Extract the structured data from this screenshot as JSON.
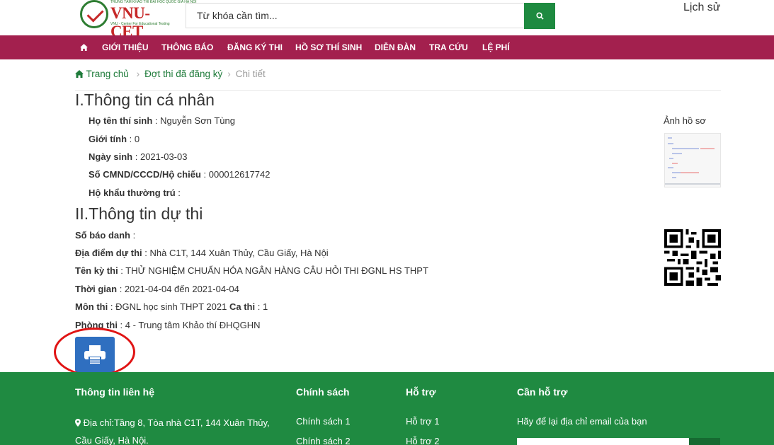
{
  "header": {
    "logo_text": "VNU-CET",
    "logo_top": "TRUNG TÂM KHẢO THÍ ĐẠI HỌC QUỐC GIA HÀ NỘI",
    "logo_sub": "VNU - Center For Educational Testing",
    "search_placeholder": "Từ khóa cần tìm...",
    "history_label": "Lịch sử"
  },
  "nav": {
    "home_icon": "home-icon",
    "items": [
      {
        "label": "GIỚI THIỆU"
      },
      {
        "label": "THÔNG BÁO"
      },
      {
        "label": "ĐĂNG KÝ THI"
      },
      {
        "label": "HỒ SƠ THÍ SINH"
      },
      {
        "label": "DIỄN ĐÀN"
      },
      {
        "label": "TRA CỨU"
      },
      {
        "label": "LỆ PHÍ"
      }
    ]
  },
  "breadcrumb": {
    "home": "Trang chủ",
    "registered": "Đợt thi đã đăng ký",
    "current": "Chi tiết"
  },
  "personal": {
    "title": "I.Thông tin cá nhân",
    "name_label": "Họ tên thí sinh",
    "name_value": "Nguyễn Sơn Tùng",
    "gender_label": "Giới tính",
    "gender_value": "0",
    "dob_label": "Ngày sinh",
    "dob_value": "2021-03-03",
    "id_label": "Số CMND/CCCD/Hộ chiếu",
    "id_value": "000012617742",
    "residence_label": "Hộ khẩu thường trú",
    "residence_value": ""
  },
  "photo": {
    "label": "Ảnh hồ sơ"
  },
  "exam": {
    "title": "II.Thông tin dự thi",
    "sbd_label": "Số báo danh",
    "sbd_value": "",
    "location_label": "Địa điểm dự thi",
    "location_value": "Nhà C1T, 144 Xuân Thủy, Cầu Giấy, Hà Nội",
    "exam_name_label": "Tên kỳ thi",
    "exam_name_value": "THỬ NGHIỆM CHUẨN HÓA NGÂN HÀNG CÂU HỎI THI ĐGNL HS THPT",
    "time_label": "Thời gian",
    "time_value": "2021-04-04 đến 2021-04-04",
    "subject_label": "Môn thi",
    "subject_value": "ĐGNL học sinh THPT 2021",
    "session_label": "Ca thi",
    "session_value": "1",
    "room_label": "Phòng thi",
    "room_value": "4 - Trung tâm Khảo thí ĐHQGHN"
  },
  "print_icon": "printer-icon",
  "footer": {
    "contact_title": "Thông tin liên hệ",
    "address_line1": "Địa chỉ:Tầng 8, Tòa nhà C1T, 144 Xuân Thủy,",
    "address_line2": "Cầu Giấy, Hà Nội.",
    "policy_title": "Chính sách",
    "policy_1": "Chính sách 1",
    "policy_2": "Chính sách 2",
    "support_title": "Hỗ trợ",
    "support_1": "Hỗ trợ 1",
    "support_2": "Hỗ trợ 2",
    "need_help_title": "Cần hỗ trợ",
    "need_help_text": "Hãy để lại địa chỉ email của bạn"
  },
  "colors": {
    "nav_bg": "#a3204e",
    "footer_bg": "#1f8a41",
    "accent_green": "#1e8a40",
    "print_blue": "#2f6fc0",
    "highlight_red": "#e01414"
  }
}
